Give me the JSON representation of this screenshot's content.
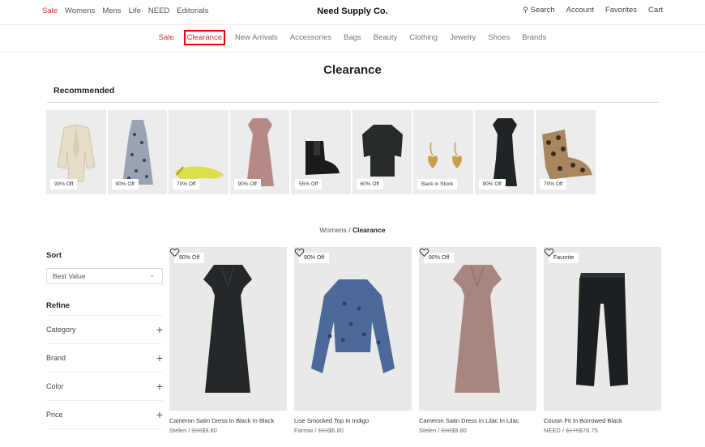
{
  "header": {
    "nav": [
      {
        "label": "Sale",
        "sale": true
      },
      {
        "label": "Womens"
      },
      {
        "label": "Mens"
      },
      {
        "label": "Life"
      },
      {
        "label": "NEED"
      },
      {
        "label": "Editorials"
      }
    ],
    "brand": "Need Supply Co.",
    "search_label": "Search",
    "account_label": "Account",
    "favorites_label": "Favorites",
    "cart_label": "Cart"
  },
  "subnav": [
    "Sale",
    "Clearance",
    "New Arrivals",
    "Accessories",
    "Bags",
    "Beauty",
    "Clothing",
    "Jewelry",
    "Shoes",
    "Brands"
  ],
  "page": {
    "title": "Clearance"
  },
  "recommended": {
    "title": "Recommended",
    "items": [
      {
        "badge": "90% Off",
        "icon": "blazer"
      },
      {
        "badge": "90% Off",
        "icon": "floral-dress"
      },
      {
        "badge": "70% Off",
        "icon": "yellow-flat"
      },
      {
        "badge": "90% Off",
        "icon": "pink-dress"
      },
      {
        "badge": "55% Off",
        "icon": "chelsea-boot"
      },
      {
        "badge": "60% Off",
        "icon": "black-top"
      },
      {
        "badge": "Back in Stock",
        "icon": "heart-earrings"
      },
      {
        "badge": "90% Off",
        "icon": "black-dress"
      },
      {
        "badge": "70% Off",
        "icon": "snake-boot"
      }
    ]
  },
  "breadcrumb": {
    "parent": "Womens",
    "sep": "/",
    "current": "Clearance"
  },
  "sidebar": {
    "sort_heading": "Sort",
    "sort_value": "Best Value",
    "refine_heading": "Refine",
    "facets": [
      "Category",
      "Brand",
      "Color",
      "Price"
    ]
  },
  "products": [
    {
      "badge": "90% Off",
      "name": "Cameron Satin Dress In Black In Black",
      "brand": "Stelen",
      "old_price": "$98",
      "price": "$9.80",
      "image": "black-dress"
    },
    {
      "badge": "90% Off",
      "name": "Lise Smocked Top In Indigo",
      "brand": "Farrow",
      "old_price": "$68",
      "price": "$6.80",
      "image": "blue-top"
    },
    {
      "badge": "90% Off",
      "name": "Cameron Satin Dress In Lilac In Lilac",
      "brand": "Stelen",
      "old_price": "$98",
      "price": "$9.80",
      "image": "lilac-dress"
    },
    {
      "badge": "Favorite",
      "name": "Cousin Fit In Borrowed Black",
      "brand": "NEED",
      "old_price": "$175",
      "price": "$78.75",
      "image": "black-jeans"
    }
  ],
  "colors": {
    "sale_red": "#d0312d",
    "highlight_box": "#e00000"
  }
}
